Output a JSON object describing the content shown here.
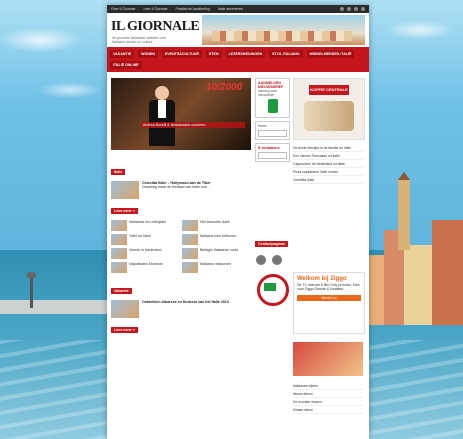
{
  "site": {
    "topbar": [
      "Over Il Giornale",
      "Leer Il Giornale",
      "Praktische Aankleding",
      "Italie adverteren"
    ],
    "logo": "IL GIORNALE",
    "tagline": "de grootste Italiaanse website over Italiaans wonen en cultuur",
    "nav": [
      "VAKANTIE",
      "WONEN",
      "EVENTS&CULTUUR",
      "ETEN",
      "LEZERSMENINGEN",
      "STIJL ITALIANO",
      "WINKELMERKEN ITALIË",
      "ITALIË ONLINE"
    ],
    "hero": {
      "number": "10/2000",
      "caption": "Andrea Bocelli & famosissimo concerto"
    },
    "mid": {
      "subscribe_title": "AANMELDEN NIEUWSBRIEF",
      "subscribe_sub": "ontvang onze nieuwsbrief",
      "search_label": "Naam",
      "agenda_title": "E-invitations",
      "section_label": "Contactpaginas"
    },
    "ad1": {
      "brand": "KOFFIE CENTRALE"
    },
    "left": {
      "section1": "Italie",
      "lead_title": "Cinecitta Italie – Hollywood aan de Tiber",
      "lead_text": "Geweldig maar de filmstad van italie ook...",
      "more": "Lees meer »",
      "items": [
        "Italiaanse kro ontbijtdel",
        "Het bezochte Italie",
        "Tafel vol Italie",
        "Italiaans kom eetkunst",
        "Vinerie in Nederland",
        "Bellagio Italiaanse roots",
        "Napolitaans Museum",
        "Italiaans restaurant"
      ],
      "section2": "Vakantie",
      "lead2_title": "Ontdekken Albarese en Hodesio van het Italie 2013",
      "more2": "Lees meer »"
    },
    "right": {
      "list": [
        "De beste feestjes in de familie en Italie",
        "Een nieuwe Parmasan uit Italie",
        "Cappuccino de Nederland uit Italie",
        "Pizza kapitalisme Italie wonen",
        "Cinecitta Italie"
      ],
      "ziggo_title": "Welkom bij Ziggo",
      "ziggo_text": "Dé TV Internet & Bel-Only provider. Kies voor Ziggo Gemak & Kwaliteit.",
      "ziggo_button": "Bestel nu",
      "more_list": [
        "Italiaanse wijnen",
        "Nieuw album",
        "De mooiste dorpen",
        "Estate ottimo"
      ]
    }
  },
  "colors": {
    "brand_red": "#c4161c",
    "nav_dark": "#a80f14",
    "ziggo_orange": "#e8681c"
  }
}
